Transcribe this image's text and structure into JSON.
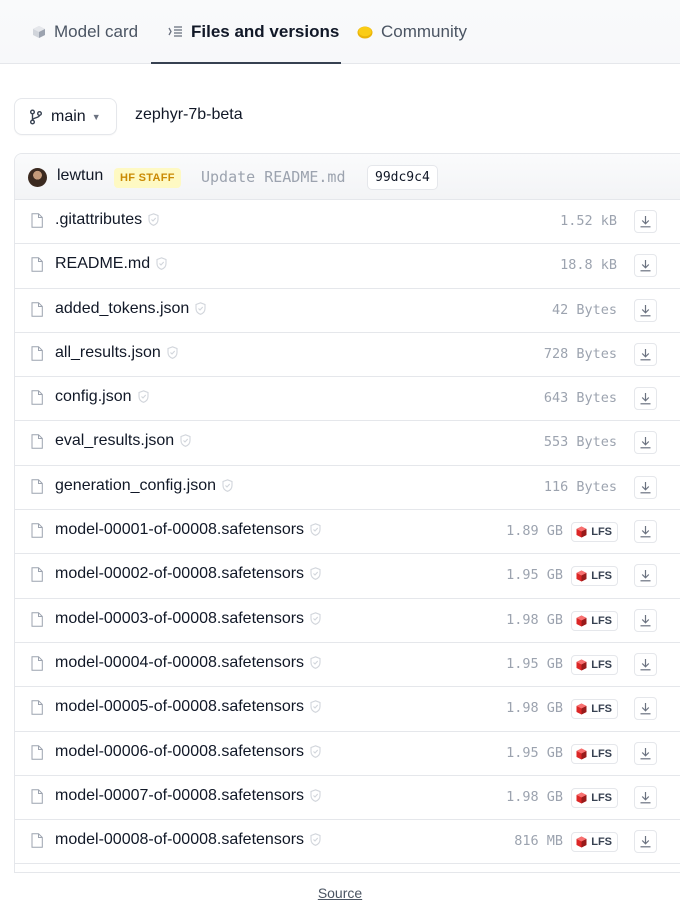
{
  "tabs": [
    {
      "label": "Model card",
      "icon": "cube-icon"
    },
    {
      "label": "Files and versions",
      "icon": "files-icon",
      "active": true
    },
    {
      "label": "Community",
      "icon": "community-icon"
    }
  ],
  "branch": {
    "label": "main",
    "icon": "branch-icon"
  },
  "repo_path": "zephyr-7b-beta",
  "commit": {
    "author": "lewtun",
    "badge": "HF STAFF",
    "message": "Update README.md",
    "hash": "99dc9c4"
  },
  "lfs_label": "LFS",
  "files": [
    {
      "name": ".gitattributes",
      "size": "1.52 kB",
      "lfs": false
    },
    {
      "name": "README.md",
      "size": "18.8 kB",
      "lfs": false
    },
    {
      "name": "added_tokens.json",
      "size": "42 Bytes",
      "lfs": false
    },
    {
      "name": "all_results.json",
      "size": "728 Bytes",
      "lfs": false
    },
    {
      "name": "config.json",
      "size": "643 Bytes",
      "lfs": false
    },
    {
      "name": "eval_results.json",
      "size": "553 Bytes",
      "lfs": false
    },
    {
      "name": "generation_config.json",
      "size": "116 Bytes",
      "lfs": false
    },
    {
      "name": "model-00001-of-00008.safetensors",
      "size": "1.89 GB",
      "lfs": true
    },
    {
      "name": "model-00002-of-00008.safetensors",
      "size": "1.95 GB",
      "lfs": true
    },
    {
      "name": "model-00003-of-00008.safetensors",
      "size": "1.98 GB",
      "lfs": true
    },
    {
      "name": "model-00004-of-00008.safetensors",
      "size": "1.95 GB",
      "lfs": true
    },
    {
      "name": "model-00005-of-00008.safetensors",
      "size": "1.98 GB",
      "lfs": true
    },
    {
      "name": "model-00006-of-00008.safetensors",
      "size": "1.95 GB",
      "lfs": true
    },
    {
      "name": "model-00007-of-00008.safetensors",
      "size": "1.98 GB",
      "lfs": true
    },
    {
      "name": "model-00008-of-00008.safetensors",
      "size": "816 MB",
      "lfs": true
    }
  ],
  "footer": {
    "source_label": "Source"
  }
}
